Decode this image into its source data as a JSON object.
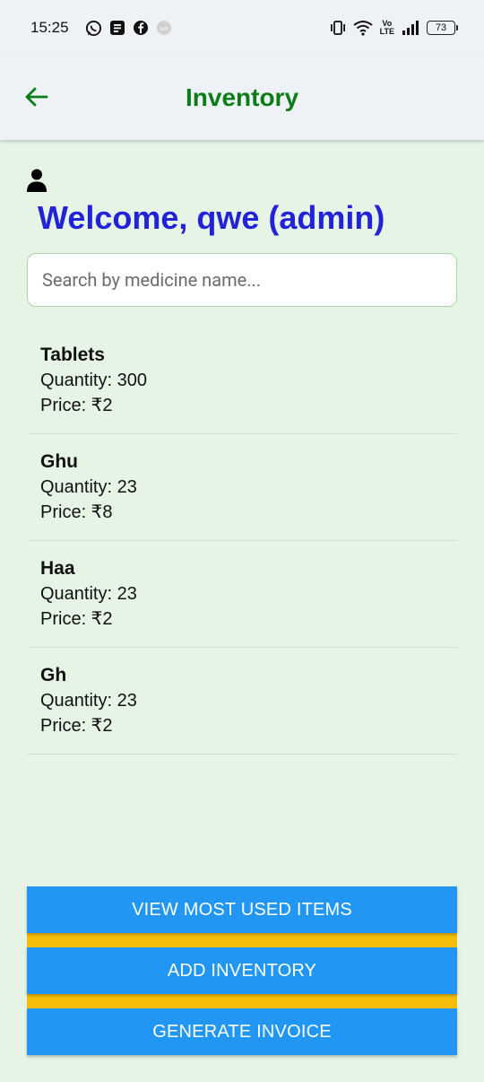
{
  "status_bar": {
    "time": "15:25",
    "left_icons": [
      "whatsapp-icon",
      "notes-icon",
      "facebook-icon",
      "app-icon"
    ],
    "battery_level": "73"
  },
  "app_bar": {
    "title": "Inventory",
    "back_icon": "arrow-left-icon",
    "accent_color": "#0b7d16"
  },
  "welcome": {
    "text": "Welcome, qwe (admin)",
    "color": "#2222d6"
  },
  "search": {
    "placeholder": "Search by medicine name...",
    "value": ""
  },
  "items": [
    {
      "name": "Tablets",
      "quantity": "Quantity: 300",
      "price": "Price: ₹2"
    },
    {
      "name": "Ghu",
      "quantity": "Quantity: 23",
      "price": "Price: ₹8"
    },
    {
      "name": "Haa",
      "quantity": "Quantity: 23",
      "price": "Price: ₹2"
    },
    {
      "name": "Gh",
      "quantity": "Quantity: 23",
      "price": "Price: ₹2"
    }
  ],
  "buttons": {
    "view_most_used": "VIEW MOST USED ITEMS",
    "add_inventory": "ADD INVENTORY",
    "generate_invoice": "GENERATE INVOICE",
    "button_color": "#2196f3",
    "strip_color": "#f5bd0a"
  }
}
